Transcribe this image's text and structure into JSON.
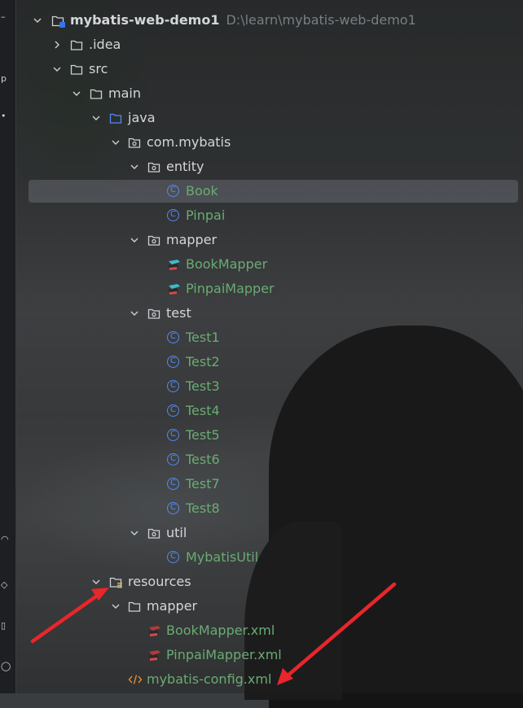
{
  "project": {
    "name": "mybatis-web-demo1",
    "path": "D:\\learn\\mybatis-web-demo1"
  },
  "tree": [
    {
      "label": "mybatis-web-demo1",
      "icon": "project-folder-icon",
      "expanded": true
    },
    {
      "label": ".idea",
      "icon": "folder-icon",
      "expanded": false
    },
    {
      "label": "src",
      "icon": "folder-icon",
      "expanded": true
    },
    {
      "label": "main",
      "icon": "folder-icon",
      "expanded": true
    },
    {
      "label": "java",
      "icon": "source-root-folder-icon",
      "expanded": true
    },
    {
      "label": "com.mybatis",
      "icon": "package-icon",
      "expanded": true
    },
    {
      "label": "entity",
      "icon": "package-icon",
      "expanded": true
    },
    {
      "label": "Book",
      "icon": "java-class-icon",
      "selected": true
    },
    {
      "label": "Pinpai",
      "icon": "java-class-icon"
    },
    {
      "label": "mapper",
      "icon": "package-icon",
      "expanded": true
    },
    {
      "label": "BookMapper",
      "icon": "mybatis-mapper-interface-icon"
    },
    {
      "label": "PinpaiMapper",
      "icon": "mybatis-mapper-interface-icon"
    },
    {
      "label": "test",
      "icon": "package-icon",
      "expanded": true
    },
    {
      "label": "Test1",
      "icon": "java-class-icon"
    },
    {
      "label": "Test2",
      "icon": "java-class-icon"
    },
    {
      "label": "Test3",
      "icon": "java-class-icon"
    },
    {
      "label": "Test4",
      "icon": "java-class-icon"
    },
    {
      "label": "Test5",
      "icon": "java-class-icon"
    },
    {
      "label": "Test6",
      "icon": "java-class-icon"
    },
    {
      "label": "Test7",
      "icon": "java-class-icon"
    },
    {
      "label": "Test8",
      "icon": "java-class-icon"
    },
    {
      "label": "util",
      "icon": "package-icon",
      "expanded": true
    },
    {
      "label": "MybatisUtil",
      "icon": "java-class-icon"
    },
    {
      "label": "resources",
      "icon": "resources-root-folder-icon",
      "expanded": true
    },
    {
      "label": "mapper",
      "icon": "folder-icon",
      "expanded": true
    },
    {
      "label": "BookMapper.xml",
      "icon": "mybatis-xml-icon"
    },
    {
      "label": "PinpaiMapper.xml",
      "icon": "mybatis-xml-icon"
    },
    {
      "label": "mybatis-config.xml",
      "icon": "xml-file-icon"
    }
  ],
  "annotations": [
    {
      "icon": "red-arrow-icon",
      "points_to": "resources"
    },
    {
      "icon": "red-arrow-icon",
      "points_to": "mybatis-config.xml"
    }
  ],
  "colors": {
    "panel": "#1e1f22",
    "text": "#d4d6da",
    "changed_file_green": "#6aab73",
    "class_icon_blue": "#548af7",
    "selection": "#70737d",
    "xml_orange": "#e08a3c",
    "arrow_red": "#e8262b",
    "path_gray": "#7a7e85"
  }
}
